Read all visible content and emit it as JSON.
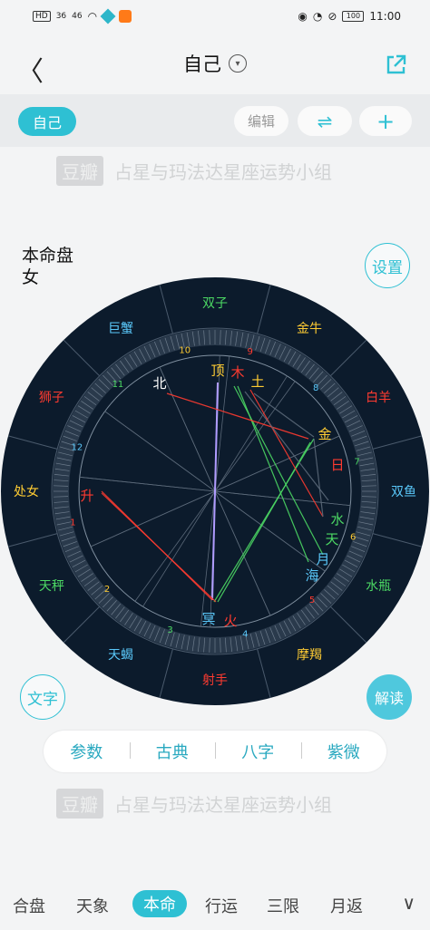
{
  "status_bar": {
    "network_badge": "HD",
    "signal": "36",
    "signal2": "46",
    "battery": "100",
    "time": "11:00"
  },
  "header": {
    "back": "〈",
    "title": "自己",
    "title_dropdown_icon": "chevron-down-icon",
    "share_icon": "share-icon"
  },
  "toolbar": {
    "selected_tag": "自己",
    "edit_label": "编辑",
    "swap_label": "⇌",
    "add_label": "+"
  },
  "watermark": {
    "logo": "豆瓣",
    "text": "占星与玛法达星座运势小组"
  },
  "chart_info": {
    "line1": "本命盘",
    "line2": "女"
  },
  "buttons": {
    "settings": "设置",
    "text": "文字",
    "interpret": "解读"
  },
  "signs": [
    {
      "name": "双子",
      "color": "#4cd964"
    },
    {
      "name": "金牛",
      "color": "#ffcc33"
    },
    {
      "name": "白羊",
      "color": "#ff3b30"
    },
    {
      "name": "双鱼",
      "color": "#5ac8fa"
    },
    {
      "name": "水瓶",
      "color": "#4cd964"
    },
    {
      "name": "摩羯",
      "color": "#ffcc33"
    },
    {
      "name": "射手",
      "color": "#ff3b30"
    },
    {
      "name": "天蝎",
      "color": "#5ac8fa"
    },
    {
      "name": "天秤",
      "color": "#4cd964"
    },
    {
      "name": "处女",
      "color": "#ffcc33"
    },
    {
      "name": "狮子",
      "color": "#ff3b30"
    },
    {
      "name": "巨蟹",
      "color": "#5ac8fa"
    }
  ],
  "house_numbers": [
    "9",
    "8",
    "7",
    "6",
    "5",
    "4",
    "3",
    "2",
    "1",
    "12",
    "11",
    "10"
  ],
  "planets": [
    {
      "name": "顶",
      "color": "#ffcc33"
    },
    {
      "name": "木",
      "color": "#ff3b30"
    },
    {
      "name": "土",
      "color": "#ffcc33"
    },
    {
      "name": "北",
      "color": "#ffffff"
    },
    {
      "name": "金",
      "color": "#ffcc33"
    },
    {
      "name": "日",
      "color": "#ff3b30"
    },
    {
      "name": "水",
      "color": "#4cd964"
    },
    {
      "name": "天",
      "color": "#4cd964"
    },
    {
      "name": "月",
      "color": "#5ac8fa"
    },
    {
      "name": "海",
      "color": "#5ac8fa"
    },
    {
      "name": "升",
      "color": "#ff3b30"
    },
    {
      "name": "冥",
      "color": "#5ac8fa"
    },
    {
      "name": "火",
      "color": "#ff3b30"
    }
  ],
  "segments": [
    "参数",
    "古典",
    "八字",
    "紫微"
  ],
  "bottom_tabs": [
    "合盘",
    "天象",
    "本命",
    "行运",
    "三限",
    "月返"
  ],
  "bottom_more": "∨",
  "colors": {
    "accent": "#2ec0d3",
    "chart_bg": "#0c1b2c"
  }
}
